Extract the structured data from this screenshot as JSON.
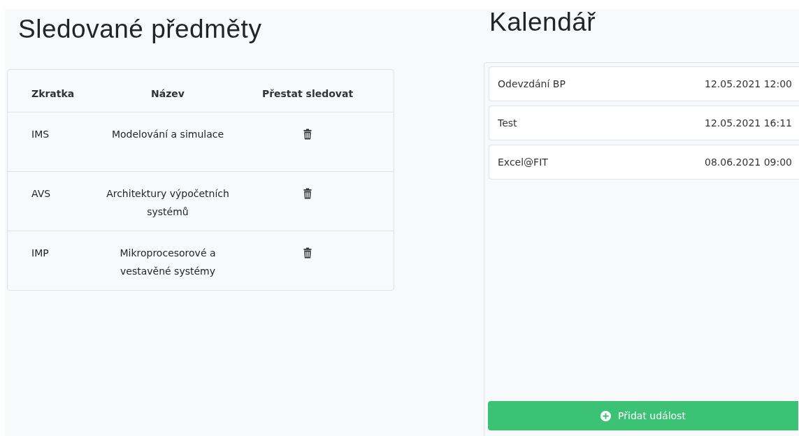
{
  "subjects": {
    "title": "Sledované předměty",
    "columns": [
      "Zkratka",
      "Název",
      "Přestat sledovat"
    ],
    "rows": [
      {
        "code": "IMS",
        "name": "Modelování a simulace"
      },
      {
        "code": "AVS",
        "name": "Architektury výpočetních systémů"
      },
      {
        "code": "IMP",
        "name": "Mikroprocesorové a vestavěné systémy"
      }
    ]
  },
  "calendar": {
    "title": "Kalendář",
    "events": [
      {
        "name": "Odevzdání BP",
        "date": "12.05.2021 12:00"
      },
      {
        "name": "Test",
        "date": "12.05.2021 16:11"
      },
      {
        "name": "Excel@FIT",
        "date": "08.06.2021 09:00"
      }
    ],
    "add_button": "Přidat událost"
  }
}
